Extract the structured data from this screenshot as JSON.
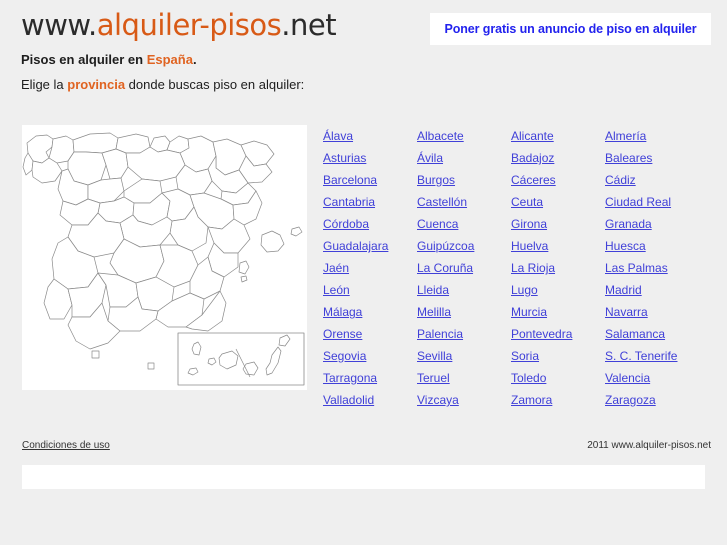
{
  "site": {
    "logo_prefix": "www.",
    "logo_brand": "alquiler-pisos",
    "logo_suffix": ".net"
  },
  "promo": {
    "label": "Poner gratis un anuncio de piso en alquiler",
    "background": "#ffffff",
    "text_color": "#2222ee"
  },
  "intro": {
    "subtitle_prefix": "Pisos en alquiler en ",
    "subtitle_country": "España",
    "subtitle_suffix": ".",
    "instruction_prefix": "Elige la ",
    "instruction_keyword": "provincia",
    "instruction_suffix": " donde buscas piso en alquiler:"
  },
  "map": {
    "alt": "Mapa de provincias de España",
    "inset_label": "Islas Canarias",
    "fill": "#ffffff",
    "stroke": "#808080"
  },
  "provinces": {
    "columns": [
      [
        "Álava",
        "Asturias",
        "Barcelona",
        "Cantabria",
        "Córdoba",
        "Guadalajara",
        "Jaén",
        "León",
        "Málaga",
        "Orense",
        "Segovia",
        "Tarragona",
        "Valladolid"
      ],
      [
        "Albacete",
        "Ávila",
        "Burgos",
        "Castellón",
        "Cuenca",
        "Guipúzcoa",
        "La Coruña",
        "Lleida",
        "Melilla",
        "Palencia",
        "Sevilla",
        "Teruel",
        "Vizcaya"
      ],
      [
        "Alicante",
        "Badajoz",
        "Cáceres",
        "Ceuta",
        "Girona",
        "Huelva",
        "La Rioja",
        "Lugo",
        "Murcia",
        "Pontevedra",
        "Soria",
        "Toledo",
        "Zamora"
      ],
      [
        "Almería",
        "Baleares",
        "Cádiz",
        "Ciudad Real",
        "Granada",
        "Huesca",
        "Las Palmas",
        "Madrid",
        "Navarra",
        "Salamanca",
        "S. C. Tenerife",
        "Valencia",
        "Zaragoza"
      ]
    ],
    "link_color": "#4040d8"
  },
  "footer": {
    "terms_label": "Condiciones de uso",
    "copyright": "2011 www.alquiler-pisos.net"
  },
  "theme": {
    "page_background": "#efefef",
    "accent_orange": "#e06321",
    "text_dark": "#1d1d1d"
  }
}
